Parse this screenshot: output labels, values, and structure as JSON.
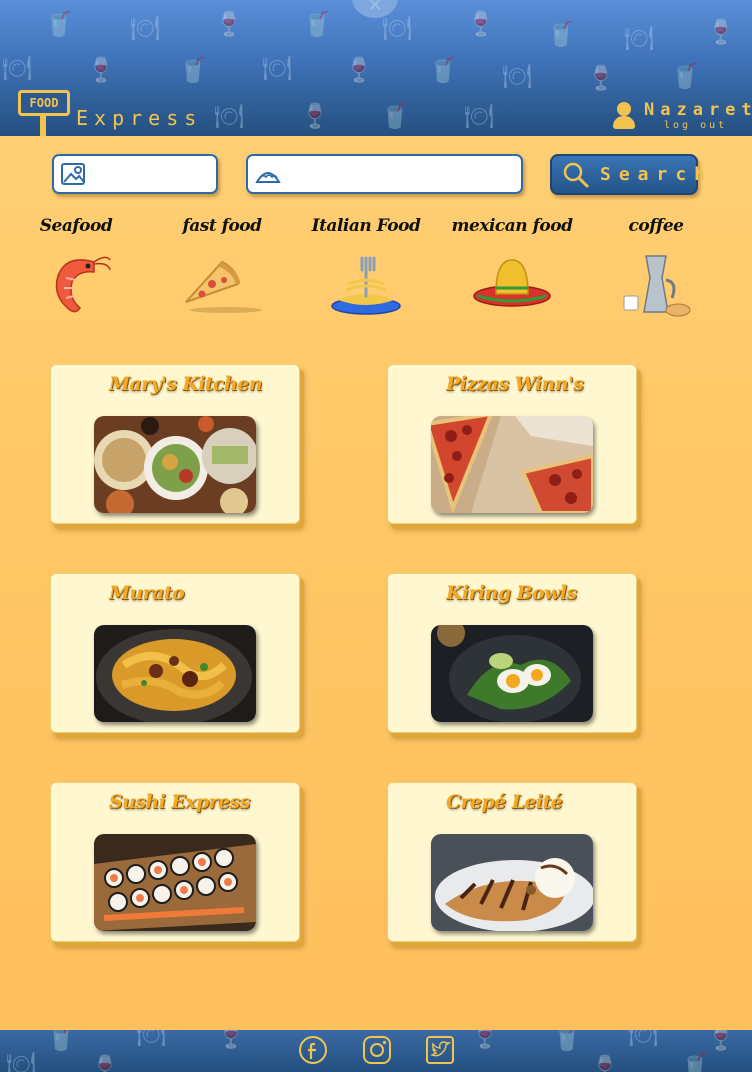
{
  "header": {
    "logo_sign": "FOOD",
    "logo_text": "Express",
    "user_name": "Nazaret",
    "logout_label": "log out"
  },
  "search": {
    "location_placeholder": "",
    "food_placeholder": "",
    "button_label": "Search"
  },
  "categories": [
    {
      "label": "Seafood",
      "icon": "shrimp-icon"
    },
    {
      "label": "fast food",
      "icon": "pizza-slice-icon"
    },
    {
      "label": "Italian Food",
      "icon": "spaghetti-icon"
    },
    {
      "label": "mexican food",
      "icon": "sombrero-icon"
    },
    {
      "label": "coffee",
      "icon": "coffee-pot-icon"
    }
  ],
  "restaurants": [
    {
      "name": "Mary's Kitchen",
      "photo": "mixed-dishes-photo"
    },
    {
      "name": "Pizzas Winn's",
      "photo": "pepperoni-pizza-photo"
    },
    {
      "name": "Murato",
      "photo": "pappardelle-ragu-photo"
    },
    {
      "name": "Kiring Bowls",
      "photo": "egg-salad-bowl-photo"
    },
    {
      "name": "Sushi Express",
      "photo": "sushi-boat-photo"
    },
    {
      "name": "Crepé Leité",
      "photo": "chocolate-crepe-photo"
    }
  ],
  "footer": {
    "social": [
      "facebook-icon",
      "instagram-icon",
      "twitter-icon"
    ]
  },
  "colors": {
    "header_top": "#5a8fd8",
    "header_bottom": "#24507f",
    "accent_yellow": "#f2c44f",
    "card_background": "#fff7cf",
    "card_title": "#f2a928",
    "page_background": "#ffc766"
  }
}
